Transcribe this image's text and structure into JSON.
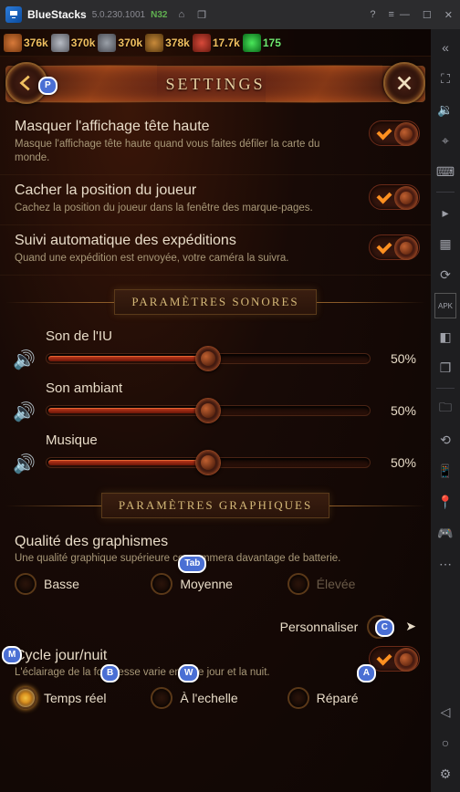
{
  "bs": {
    "title": "BlueStacks",
    "version": "5.0.230.1001",
    "flag": "N32"
  },
  "resources": {
    "copper": "376k",
    "iron": "370k",
    "stone": "370k",
    "wood": "378k",
    "food": "17.7k",
    "gems": "175"
  },
  "header": {
    "title": "SETTINGS"
  },
  "toggles": [
    {
      "title": "Masquer l'affichage tête haute",
      "desc": "Masque l'affichage tête haute quand vous faites défiler la carte du monde."
    },
    {
      "title": "Cacher la position du joueur",
      "desc": "Cachez la position du joueur dans la fenêtre des marque-pages."
    },
    {
      "title": "Suivi automatique des expéditions",
      "desc": "Quand une expédition est envoyée, votre caméra la suivra."
    }
  ],
  "sections": {
    "sound": "PARAMÈTRES SONORES",
    "graphics": "PARAMÈTRES GRAPHIQUES"
  },
  "sliders": [
    {
      "label": "Son de l'IU",
      "value": "50%",
      "pct": 50
    },
    {
      "label": "Son ambiant",
      "value": "50%",
      "pct": 50
    },
    {
      "label": "Musique",
      "value": "50%",
      "pct": 50
    }
  ],
  "gfx_quality": {
    "title": "Qualité des graphismes",
    "desc": "Une qualité graphique supérieure consommera davantage de batterie.",
    "options": [
      "Basse",
      "Moyenne",
      "Élevée"
    ],
    "custom": "Personnaliser"
  },
  "daynight": {
    "title": "Cycle jour/nuit",
    "desc": "L'éclairage de la forteresse varie entre le jour et la nuit.",
    "options": [
      "Temps réel",
      "À l'echelle",
      "Réparé"
    ]
  },
  "keys": {
    "p": "P",
    "tab": "Tab",
    "c": "C",
    "m": "M",
    "b": "B",
    "w": "W",
    "a": "A"
  }
}
